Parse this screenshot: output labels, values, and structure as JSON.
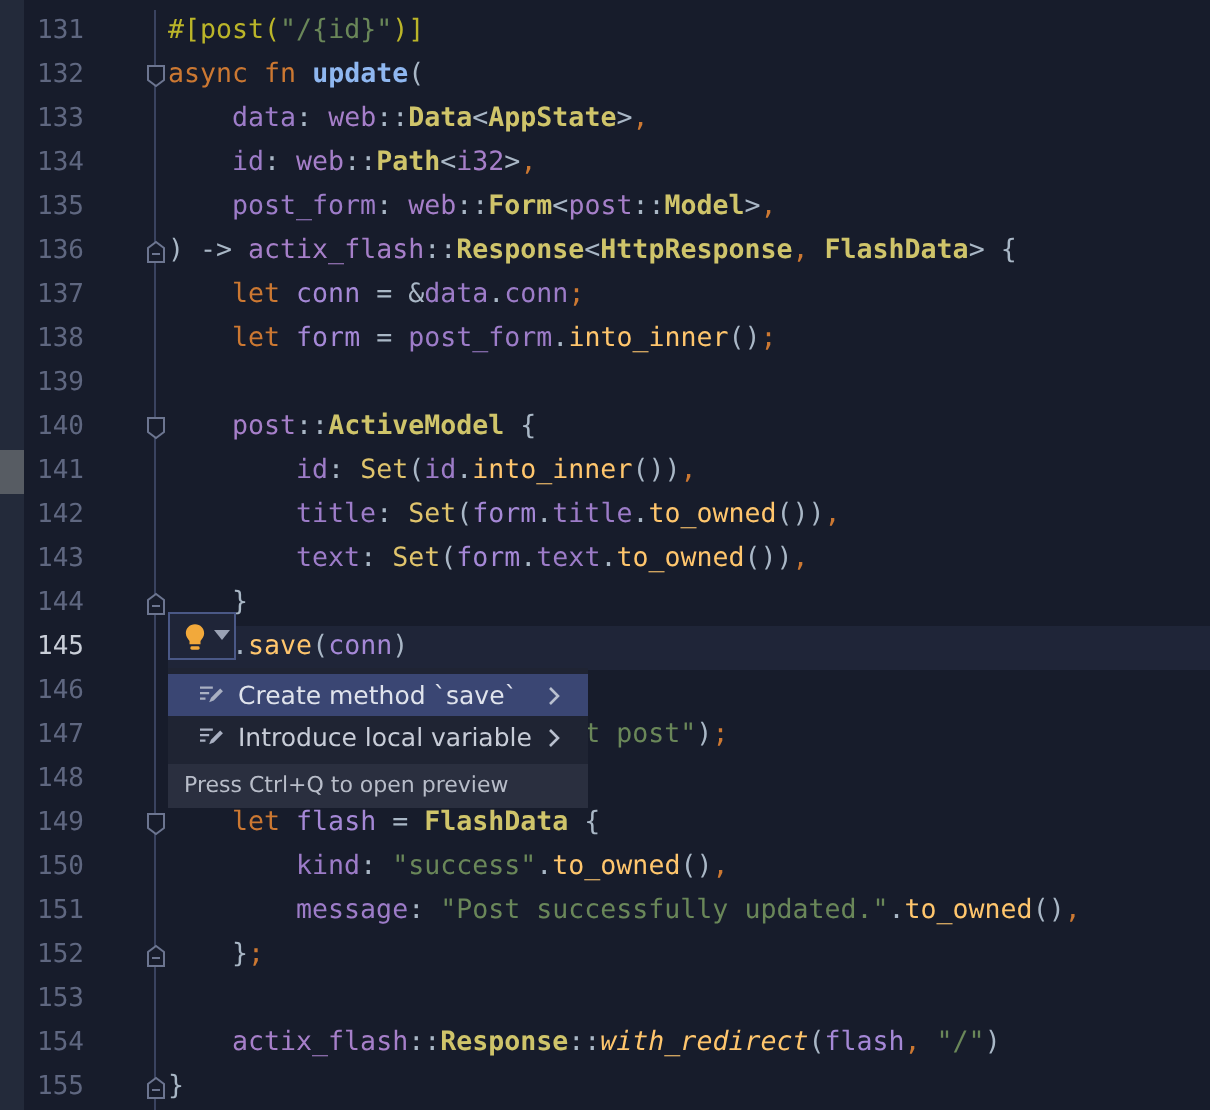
{
  "editor": {
    "lines": [
      {
        "number": "131",
        "kind": "plain",
        "current": false,
        "marked": false,
        "covered": false,
        "tokens": [
          {
            "t": "#[post(",
            "kind": "attr"
          },
          {
            "t": "\"/{id}\"",
            "kind": "str"
          },
          {
            "t": ")]",
            "kind": "attr"
          }
        ]
      },
      {
        "number": "132",
        "kind": "fold_start",
        "current": false,
        "marked": false,
        "covered": false,
        "tokens": [
          {
            "t": "async ",
            "kind": "kw"
          },
          {
            "t": "fn ",
            "kind": "kw"
          },
          {
            "t": "update",
            "kind": "fn"
          },
          {
            "t": "(",
            "kind": "p"
          }
        ],
        "children": [
          {
            "number": "133",
            "kind": "plain",
            "current": false,
            "marked": false,
            "covered": false,
            "tokens": [
              {
                "t": "data",
                "kind": "param"
              },
              {
                "t": ": ",
                "kind": "p"
              },
              {
                "t": "web",
                "kind": "mod"
              },
              {
                "t": "::",
                "kind": "p"
              },
              {
                "t": "Data",
                "kind": "type"
              },
              {
                "t": "<",
                "kind": "p"
              },
              {
                "t": "AppState",
                "kind": "type"
              },
              {
                "t": ">",
                "kind": "p"
              },
              {
                "t": ",",
                "kind": "c"
              }
            ]
          },
          {
            "number": "134",
            "kind": "plain",
            "current": false,
            "marked": false,
            "covered": false,
            "tokens": [
              {
                "t": "id",
                "kind": "param"
              },
              {
                "t": ": ",
                "kind": "p"
              },
              {
                "t": "web",
                "kind": "mod"
              },
              {
                "t": "::",
                "kind": "p"
              },
              {
                "t": "Path",
                "kind": "type"
              },
              {
                "t": "<",
                "kind": "p"
              },
              {
                "t": "i32",
                "kind": "mod"
              },
              {
                "t": ">",
                "kind": "p"
              },
              {
                "t": ",",
                "kind": "c"
              }
            ]
          },
          {
            "number": "135",
            "kind": "plain",
            "current": false,
            "marked": false,
            "covered": false,
            "tokens": [
              {
                "t": "post_form",
                "kind": "param"
              },
              {
                "t": ": ",
                "kind": "p"
              },
              {
                "t": "web",
                "kind": "mod"
              },
              {
                "t": "::",
                "kind": "p"
              },
              {
                "t": "Form",
                "kind": "type"
              },
              {
                "t": "<",
                "kind": "p"
              },
              {
                "t": "post",
                "kind": "mod"
              },
              {
                "t": "::",
                "kind": "p"
              },
              {
                "t": "Model",
                "kind": "type"
              },
              {
                "t": ">",
                "kind": "p"
              },
              {
                "t": ",",
                "kind": "c"
              }
            ]
          }
        ]
      },
      {
        "number": "136",
        "kind": "fold_end",
        "current": false,
        "marked": false,
        "covered": false,
        "tokens": [
          {
            "t": ") -> ",
            "kind": "p"
          },
          {
            "t": "actix_flash",
            "kind": "mod"
          },
          {
            "t": "::",
            "kind": "p"
          },
          {
            "t": "Response",
            "kind": "type"
          },
          {
            "t": "<",
            "kind": "p"
          },
          {
            "t": "HttpResponse",
            "kind": "type"
          },
          {
            "t": ", ",
            "kind": "c"
          },
          {
            "t": "FlashData",
            "kind": "type"
          },
          {
            "t": "> {",
            "kind": "p"
          }
        ],
        "children": [
          {
            "number": "137",
            "kind": "plain",
            "current": false,
            "marked": false,
            "covered": false,
            "tokens": [
              {
                "t": "let ",
                "kind": "kw"
              },
              {
                "t": "conn",
                "kind": "var"
              },
              {
                "t": " = &",
                "kind": "p"
              },
              {
                "t": "data",
                "kind": "param"
              },
              {
                "t": ".",
                "kind": "p"
              },
              {
                "t": "conn",
                "kind": "param"
              },
              {
                "t": ";",
                "kind": "c"
              }
            ]
          },
          {
            "number": "138",
            "kind": "plain",
            "current": false,
            "marked": false,
            "covered": false,
            "tokens": [
              {
                "t": "let ",
                "kind": "kw"
              },
              {
                "t": "form",
                "kind": "var"
              },
              {
                "t": " = ",
                "kind": "p"
              },
              {
                "t": "post_form",
                "kind": "param"
              },
              {
                "t": ".",
                "kind": "p"
              },
              {
                "t": "into_inner",
                "kind": "method"
              },
              {
                "t": "()",
                "kind": "p"
              },
              {
                "t": ";",
                "kind": "c"
              }
            ]
          },
          {
            "number": "139",
            "kind": "plain",
            "current": false,
            "marked": false
          },
          {
            "number": "140",
            "kind": "fold_start",
            "current": false,
            "marked": false,
            "covered": false,
            "tokens": [
              {
                "t": "post",
                "kind": "mod"
              },
              {
                "t": "::",
                "kind": "p"
              },
              {
                "t": "ActiveModel",
                "kind": "type"
              },
              {
                "t": " {",
                "kind": "p"
              }
            ],
            "children": [
              {
                "number": "141",
                "kind": "plain",
                "current": false,
                "marked": true,
                "covered": false,
                "tokens": [
                  {
                    "t": "id",
                    "kind": "param"
                  },
                  {
                    "t": ": ",
                    "kind": "p"
                  },
                  {
                    "t": "Set",
                    "kind": "call"
                  },
                  {
                    "t": "(",
                    "kind": "p"
                  },
                  {
                    "t": "id",
                    "kind": "param"
                  },
                  {
                    "t": ".",
                    "kind": "p"
                  },
                  {
                    "t": "into_inner",
                    "kind": "method"
                  },
                  {
                    "t": "())",
                    "kind": "p"
                  },
                  {
                    "t": ",",
                    "kind": "c"
                  }
                ]
              },
              {
                "number": "142",
                "kind": "plain",
                "current": false,
                "marked": false,
                "covered": false,
                "tokens": [
                  {
                    "t": "title",
                    "kind": "param"
                  },
                  {
                    "t": ": ",
                    "kind": "p"
                  },
                  {
                    "t": "Set",
                    "kind": "call"
                  },
                  {
                    "t": "(",
                    "kind": "p"
                  },
                  {
                    "t": "form",
                    "kind": "var"
                  },
                  {
                    "t": ".",
                    "kind": "p"
                  },
                  {
                    "t": "title",
                    "kind": "param"
                  },
                  {
                    "t": ".",
                    "kind": "p"
                  },
                  {
                    "t": "to_owned",
                    "kind": "method"
                  },
                  {
                    "t": "())",
                    "kind": "p"
                  },
                  {
                    "t": ",",
                    "kind": "c"
                  }
                ]
              },
              {
                "number": "143",
                "kind": "plain",
                "current": false,
                "marked": false,
                "covered": false,
                "tokens": [
                  {
                    "t": "text",
                    "kind": "param"
                  },
                  {
                    "t": ": ",
                    "kind": "p"
                  },
                  {
                    "t": "Set",
                    "kind": "call"
                  },
                  {
                    "t": "(",
                    "kind": "p"
                  },
                  {
                    "t": "form",
                    "kind": "var"
                  },
                  {
                    "t": ".",
                    "kind": "p"
                  },
                  {
                    "t": "text",
                    "kind": "param"
                  },
                  {
                    "t": ".",
                    "kind": "p"
                  },
                  {
                    "t": "to_owned",
                    "kind": "method"
                  },
                  {
                    "t": "())",
                    "kind": "p"
                  },
                  {
                    "t": ",",
                    "kind": "c"
                  }
                ]
              }
            ]
          },
          {
            "number": "144",
            "kind": "fold_end",
            "current": false,
            "marked": false,
            "covered": false,
            "tokens": [
              {
                "t": "}",
                "kind": "p"
              }
            ]
          },
          {
            "number": "145",
            "kind": "plain",
            "current": true,
            "marked": false,
            "covered": false,
            "tokens": [
              {
                "t": ".",
                "kind": "p"
              },
              {
                "t": "save",
                "kind": "method"
              },
              {
                "t": "(",
                "kind": "p"
              },
              {
                "t": "conn",
                "kind": "var"
              },
              {
                "t": ")",
                "kind": "p"
              }
            ]
          },
          {
            "number": "146",
            "kind": "plain",
            "current": false,
            "marked": false
          },
          {
            "number": "147",
            "kind": "plain",
            "current": false,
            "marked": false,
            "covered": true,
            "tokens": [
              {
                "t": "t post\"",
                "kind": "str"
              },
              {
                "t": ")",
                "kind": "p"
              },
              {
                "t": ";",
                "kind": "c"
              }
            ]
          },
          {
            "number": "148",
            "kind": "plain",
            "current": false,
            "marked": false
          },
          {
            "number": "149",
            "kind": "fold_start",
            "current": false,
            "marked": false,
            "covered": false,
            "tokens": [
              {
                "t": "let ",
                "kind": "kw"
              },
              {
                "t": "flash",
                "kind": "var"
              },
              {
                "t": " = ",
                "kind": "p"
              },
              {
                "t": "FlashData",
                "kind": "type"
              },
              {
                "t": " {",
                "kind": "p"
              }
            ],
            "children": [
              {
                "number": "150",
                "kind": "plain",
                "current": false,
                "marked": false,
                "covered": false,
                "tokens": [
                  {
                    "t": "kind",
                    "kind": "param"
                  },
                  {
                    "t": ": ",
                    "kind": "p"
                  },
                  {
                    "t": "\"success\"",
                    "kind": "str"
                  },
                  {
                    "t": ".",
                    "kind": "p"
                  },
                  {
                    "t": "to_owned",
                    "kind": "method"
                  },
                  {
                    "t": "()",
                    "kind": "p"
                  },
                  {
                    "t": ",",
                    "kind": "c"
                  }
                ]
              },
              {
                "number": "151",
                "kind": "plain",
                "current": false,
                "marked": false,
                "covered": false,
                "tokens": [
                  {
                    "t": "message",
                    "kind": "param"
                  },
                  {
                    "t": ": ",
                    "kind": "p"
                  },
                  {
                    "t": "\"Post successfully updated.\"",
                    "kind": "str"
                  },
                  {
                    "t": ".",
                    "kind": "p"
                  },
                  {
                    "t": "to_owned",
                    "kind": "method"
                  },
                  {
                    "t": "()",
                    "kind": "p"
                  },
                  {
                    "t": ",",
                    "kind": "c"
                  }
                ]
              }
            ]
          },
          {
            "number": "152",
            "kind": "fold_end",
            "current": false,
            "marked": false,
            "covered": false,
            "tokens": [
              {
                "t": "}",
                "kind": "p"
              },
              {
                "t": ";",
                "kind": "c"
              }
            ]
          },
          {
            "number": "153",
            "kind": "plain",
            "current": false,
            "marked": false
          },
          {
            "number": "154",
            "kind": "plain",
            "current": false,
            "marked": false,
            "covered": false,
            "tokens": [
              {
                "t": "actix_flash",
                "kind": "mod"
              },
              {
                "t": "::",
                "kind": "p"
              },
              {
                "t": "Response",
                "kind": "type"
              },
              {
                "t": "::",
                "kind": "p"
              },
              {
                "t": "with_redirect",
                "kind": "italic"
              },
              {
                "t": "(",
                "kind": "p"
              },
              {
                "t": "flash",
                "kind": "var"
              },
              {
                "t": ", ",
                "kind": "c"
              },
              {
                "t": "\"/\"",
                "kind": "str"
              },
              {
                "t": ")",
                "kind": "p"
              }
            ]
          }
        ]
      },
      {
        "number": "155",
        "kind": "fold_end",
        "current": false,
        "marked": false,
        "covered": false,
        "tokens": [
          {
            "t": "}",
            "kind": "p"
          }
        ]
      }
    ]
  },
  "intention_popup": {
    "items": [
      {
        "label": "Create method `save`",
        "selected": true
      },
      {
        "label": "Introduce local variable",
        "selected": false
      }
    ],
    "hint": "Press Ctrl+Q to open preview"
  }
}
